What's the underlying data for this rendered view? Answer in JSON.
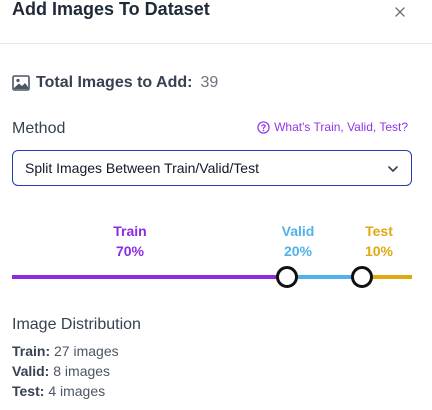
{
  "header": {
    "title": "Add Images To Dataset",
    "close_icon": "close-icon"
  },
  "total": {
    "icon": "image-icon",
    "label": "Total Images to Add:",
    "count": "39"
  },
  "method": {
    "label": "Method",
    "help_icon": "question-circle-icon",
    "help_text": "What's Train, Valid, Test?",
    "selected": "Split Images Between Train/Valid/Test"
  },
  "split": {
    "train": {
      "name": "Train",
      "percent": "70%",
      "value": 70,
      "color": "#8b2be2"
    },
    "valid": {
      "name": "Valid",
      "percent": "20%",
      "value": 20,
      "color": "#4fb3ea"
    },
    "test": {
      "name": "Test",
      "percent": "10%",
      "value": 10,
      "color": "#e0a911"
    }
  },
  "distribution": {
    "title": "Image Distribution",
    "rows": [
      {
        "label": "Train:",
        "value": "27 images"
      },
      {
        "label": "Valid:",
        "value": "8 images"
      },
      {
        "label": "Test:",
        "value": "4 images"
      }
    ]
  }
}
